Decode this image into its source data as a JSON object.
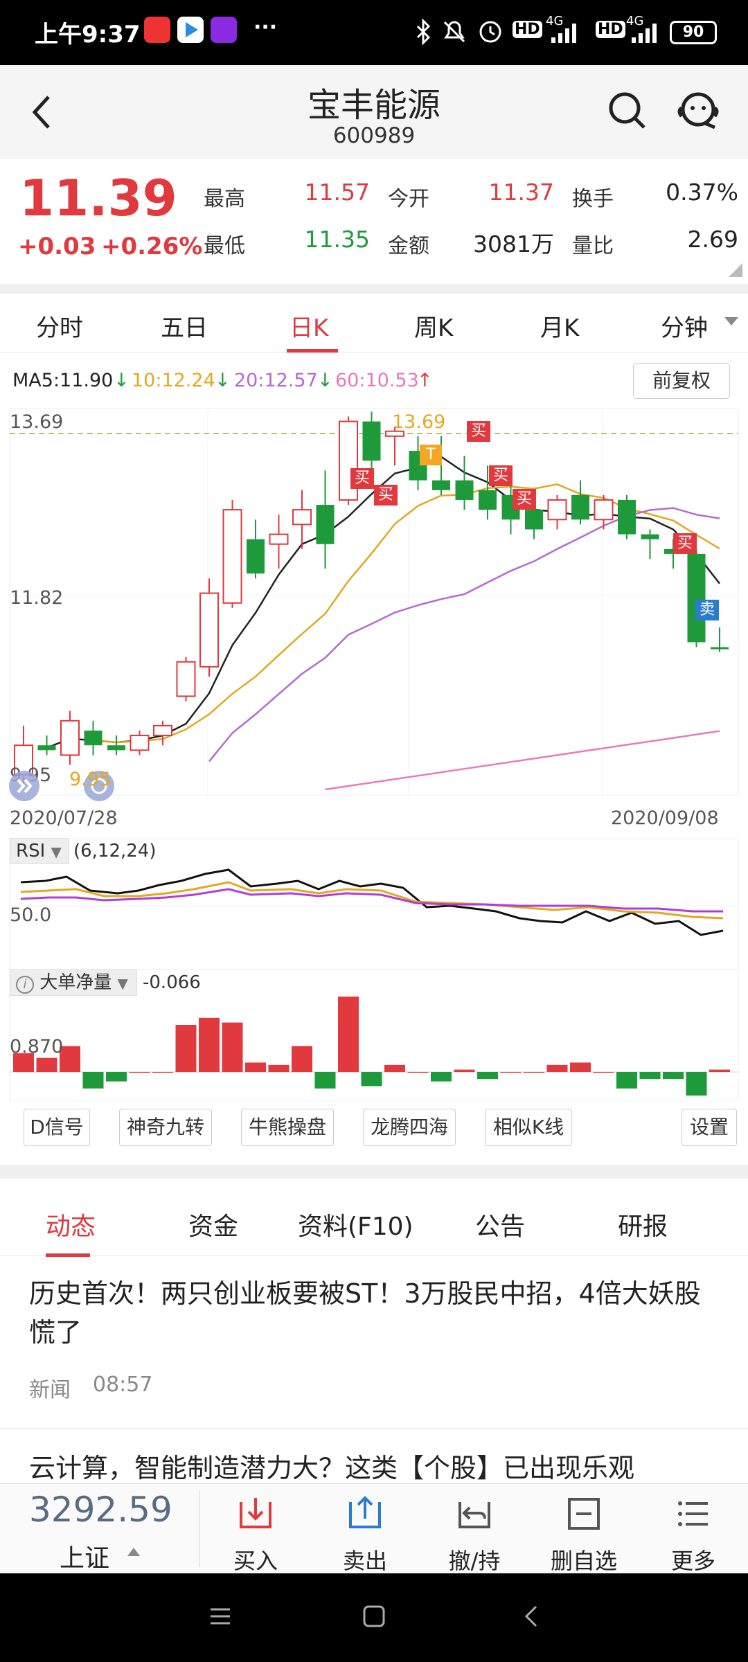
{
  "status_bar": {
    "time": "上午9:37",
    "more": "···",
    "battery": "90",
    "net1": "4G",
    "net2": "4G",
    "hd1": "HD",
    "hd2": "HD",
    "bluetooth_icon": "bluetooth-icon",
    "mute_icon": "mute-icon",
    "alarm_icon": "alarm-icon"
  },
  "header": {
    "title": "宝丰能源",
    "code": "600989",
    "back_icon": "back-icon",
    "search_icon": "search-icon",
    "service_icon": "customer-service-icon"
  },
  "quote": {
    "price": "11.39",
    "change": "+0.03",
    "change_pct": "+0.26%",
    "stats": [
      {
        "label": "最高",
        "value": "11.57"
      },
      {
        "label": "今开",
        "value": "11.37"
      },
      {
        "label": "换手",
        "value": "0.37%"
      },
      {
        "label": "最低",
        "value": "11.35"
      },
      {
        "label": "金额",
        "value": "3081万"
      },
      {
        "label": "量比",
        "value": "2.69"
      }
    ]
  },
  "chart_tabs": [
    "分时",
    "五日",
    "日K",
    "周K",
    "月K",
    "分钟"
  ],
  "active_chart_tab": "日K",
  "ma": {
    "ma5": "MA5:11.90",
    "ma10": "10:12.24",
    "ma20": "20:12.57",
    "ma60": "60:10.53"
  },
  "adjust_button": "前复权",
  "kchart": {
    "y_top": "13.69",
    "y_mid": "11.82",
    "y_bot": "9.95",
    "y_bot_marker": "9.95",
    "peak_label": "13.69",
    "date_start": "2020/07/28",
    "date_end": "2020/09/08",
    "buy_label": "买",
    "sell_label": "卖",
    "t_label": "T"
  },
  "rsi": {
    "name": "RSI",
    "params": "(6,12,24)",
    "level": "50.0"
  },
  "dadan": {
    "name": "大单净量",
    "value": "-0.066",
    "level": "0.870"
  },
  "toolbar": [
    "D信号",
    "神奇九转",
    "牛熊操盘",
    "龙腾四海",
    "相似K线",
    "设置"
  ],
  "news_tabs": [
    "动态",
    "资金",
    "资料(F10)",
    "公告",
    "研报"
  ],
  "active_news_tab": "动态",
  "news": [
    {
      "title": "历史首次！两只创业板要被ST！3万股民中招，4倍大妖股慌了",
      "source": "新闻",
      "time": "08:57"
    },
    {
      "title": "云计算，智能制造潜力大？这类【个股】已出现乐观"
    }
  ],
  "bottom_nav": {
    "index_value": "3292.59",
    "index_name": "上证",
    "items": [
      {
        "label": "买入",
        "icon": "buy-icon"
      },
      {
        "label": "卖出",
        "icon": "sell-icon"
      },
      {
        "label": "撤/持",
        "icon": "withdraw-icon"
      },
      {
        "label": "删自选",
        "icon": "remove-watchlist-icon"
      },
      {
        "label": "更多",
        "icon": "more-icon"
      }
    ]
  },
  "colors": {
    "up": "#e0393e",
    "down": "#1e9a3a",
    "ma5": "#222222",
    "ma10": "#e3a81e",
    "ma20": "#b46ad0",
    "ma60": "#e87ab8"
  },
  "candles": [
    {
      "o": 10.1,
      "h": 10.6,
      "l": 9.95,
      "c": 10.4
    },
    {
      "o": 10.4,
      "h": 10.5,
      "l": 10.3,
      "c": 10.35
    },
    {
      "o": 10.3,
      "h": 10.75,
      "l": 10.2,
      "c": 10.65
    },
    {
      "o": 10.55,
      "h": 10.65,
      "l": 10.3,
      "c": 10.4
    },
    {
      "o": 10.4,
      "h": 10.5,
      "l": 10.3,
      "c": 10.35
    },
    {
      "o": 10.35,
      "h": 10.55,
      "l": 10.3,
      "c": 10.5
    },
    {
      "o": 10.5,
      "h": 10.65,
      "l": 10.4,
      "c": 10.6
    },
    {
      "o": 10.9,
      "h": 11.3,
      "l": 10.85,
      "c": 11.25
    },
    {
      "o": 11.2,
      "h": 12.1,
      "l": 11.1,
      "c": 11.95
    },
    {
      "o": 11.85,
      "h": 12.9,
      "l": 11.8,
      "c": 12.8
    },
    {
      "o": 12.5,
      "h": 12.7,
      "l": 12.1,
      "c": 12.15
    },
    {
      "o": 12.45,
      "h": 12.75,
      "l": 12.2,
      "c": 12.55
    },
    {
      "o": 12.65,
      "h": 13.0,
      "l": 12.4,
      "c": 12.8
    },
    {
      "o": 12.85,
      "h": 13.2,
      "l": 12.2,
      "c": 12.45
    },
    {
      "o": 12.9,
      "h": 13.75,
      "l": 12.85,
      "c": 13.7
    },
    {
      "o": 13.7,
      "h": 13.8,
      "l": 13.2,
      "c": 13.3
    },
    {
      "o": 13.55,
      "h": 13.65,
      "l": 13.25,
      "c": 13.6
    },
    {
      "o": 13.4,
      "h": 13.55,
      "l": 13.0,
      "c": 13.1
    },
    {
      "o": 13.1,
      "h": 13.55,
      "l": 12.95,
      "c": 13.0
    },
    {
      "o": 13.1,
      "h": 13.35,
      "l": 12.8,
      "c": 12.9
    },
    {
      "o": 13.0,
      "h": 13.25,
      "l": 12.7,
      "c": 12.8
    },
    {
      "o": 12.95,
      "h": 13.05,
      "l": 12.55,
      "c": 12.7
    },
    {
      "o": 12.8,
      "h": 13.0,
      "l": 12.5,
      "c": 12.6
    },
    {
      "o": 12.7,
      "h": 12.95,
      "l": 12.6,
      "c": 12.9
    },
    {
      "o": 12.95,
      "h": 13.1,
      "l": 12.65,
      "c": 12.7
    },
    {
      "o": 12.7,
      "h": 12.95,
      "l": 12.6,
      "c": 12.9
    },
    {
      "o": 12.9,
      "h": 12.95,
      "l": 12.5,
      "c": 12.55
    },
    {
      "o": 12.55,
      "h": 12.6,
      "l": 12.3,
      "c": 12.5
    },
    {
      "o": 12.4,
      "h": 12.5,
      "l": 12.2,
      "c": 12.35
    },
    {
      "o": 12.35,
      "h": 12.4,
      "l": 11.4,
      "c": 11.45
    },
    {
      "o": 11.4,
      "h": 11.6,
      "l": 11.35,
      "c": 11.39
    }
  ]
}
